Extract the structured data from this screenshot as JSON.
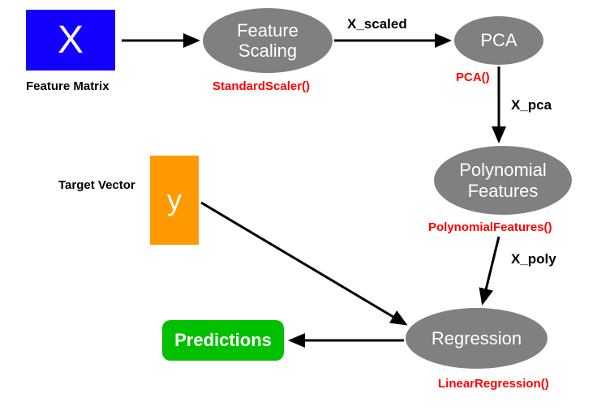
{
  "nodes": {
    "x": {
      "text": "X",
      "caption": "Feature Matrix"
    },
    "scaling": {
      "text": "Feature\nScaling",
      "code": "StandardScaler()"
    },
    "pca": {
      "text": "PCA",
      "code": "PCA()"
    },
    "poly": {
      "text": "Polynomial\nFeatures",
      "code": "PolynomialFeatures()"
    },
    "y": {
      "text": "y",
      "caption": "Target Vector"
    },
    "regression": {
      "text": "Regression",
      "code": "LinearRegression()"
    },
    "predictions": {
      "text": "Predictions"
    }
  },
  "edges": {
    "x_to_scaling": "",
    "scaling_to_pca": "X_scaled",
    "pca_to_poly": "X_pca",
    "poly_to_regression": "X_poly",
    "y_to_regression": "",
    "regression_to_predictions": ""
  }
}
